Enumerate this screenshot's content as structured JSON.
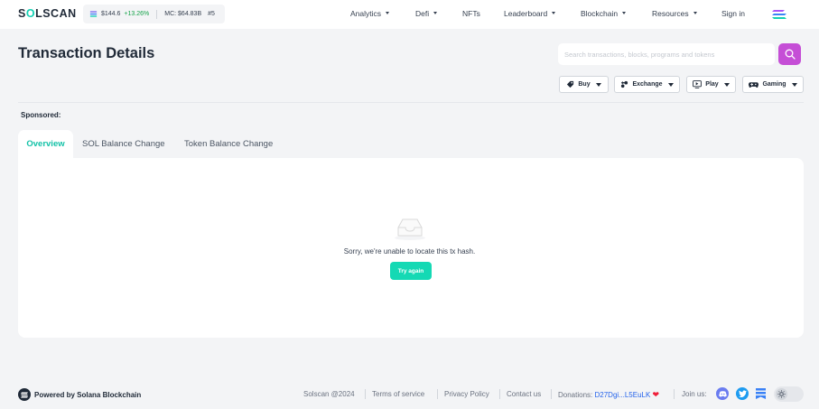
{
  "header": {
    "logo_prefix": "S",
    "logo_o": "O",
    "logo_suffix": "LSCAN",
    "sol_price": "$144.6",
    "sol_change": "+13.26%",
    "market_cap": "MC: $64.83B",
    "rank": "#5",
    "nav": [
      {
        "label": "Analytics",
        "has_dropdown": true
      },
      {
        "label": "Defi",
        "has_dropdown": true
      },
      {
        "label": "NFTs",
        "has_dropdown": false
      },
      {
        "label": "Leaderboard",
        "has_dropdown": true
      },
      {
        "label": "Blockchain",
        "has_dropdown": true
      },
      {
        "label": "Resources",
        "has_dropdown": true
      },
      {
        "label": "Sign in",
        "has_dropdown": false
      }
    ],
    "menu_icon": "solana-menu-icon"
  },
  "page": {
    "title": "Transaction Details",
    "search_placeholder": "Search transactions, blocks, programs and tokens",
    "search_icon": "search-icon"
  },
  "ads": [
    {
      "label": "Buy",
      "icon": "tag-icon"
    },
    {
      "label": "Exchange",
      "icon": "exchange-icon"
    },
    {
      "label": "Play",
      "icon": "play-icon"
    },
    {
      "label": "Gaming",
      "icon": "gamepad-icon"
    }
  ],
  "sponsored_label": "Sponsored:",
  "tabs": [
    {
      "label": "Overview",
      "active": true
    },
    {
      "label": "SOL Balance Change",
      "active": false
    },
    {
      "label": "Token Balance Change",
      "active": false
    }
  ],
  "empty_state": {
    "icon": "empty-inbox-icon",
    "message": "Sorry, we're unable to locate this tx hash.",
    "button": "Try again"
  },
  "footer": {
    "powered": "Powered by Solana Blockchain",
    "copyright": "Solscan @2024",
    "links": [
      "Terms of service",
      "Privacy Policy",
      "Contact us"
    ],
    "donations_label": "Donations:",
    "donations_address": "D27Dgi...L5EuLK",
    "join_label": "Join us:",
    "socials": [
      "discord-icon",
      "twitter-icon",
      "bookmark-icon"
    ]
  },
  "colors": {
    "accent": "#14d0b4",
    "search_button": "#c54ed6",
    "positive": "#16a34a",
    "link": "#2563eb",
    "heart": "#ef1d38"
  }
}
